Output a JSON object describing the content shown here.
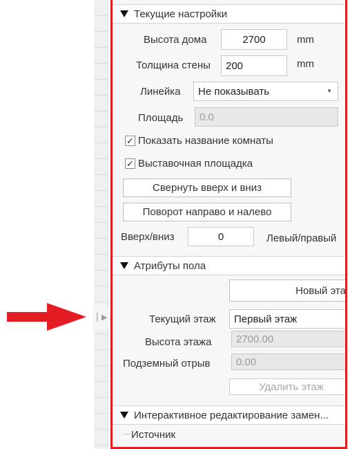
{
  "current_settings": {
    "header": "Текущие настройки",
    "house_height_label": "Высота дома",
    "house_height_value": "2700",
    "house_height_unit": "mm",
    "wall_thickness_label": "Толщина стены",
    "wall_thickness_value": "200",
    "wall_thickness_unit": "mm",
    "ruler_label": "Линейка",
    "ruler_value": "Не показывать",
    "area_label": "Площадь",
    "area_value": "0.0",
    "show_room_name_label": "Показать название комнаты",
    "show_room_name_checked": true,
    "exhibition_area_label": "Выставочная площадка",
    "exhibition_area_checked": true,
    "flip_button": "Свернуть вверх и вниз",
    "rotate_button": "Поворот направо и налево",
    "updown_label": "Вверх/вниз",
    "updown_value": "0",
    "leftright_label": "Левый/правый"
  },
  "floor_attributes": {
    "header": "Атрибуты пола",
    "new_floor_button": "Новый этаж",
    "current_floor_label": "Текущий этаж",
    "current_floor_value": "Первый этаж",
    "floor_height_label": "Высота этажа",
    "floor_height_value": "2700.00",
    "underground_label": "Подземный отрыв",
    "underground_value": "0.00",
    "delete_floor_button": "Удалить этаж"
  },
  "interactive_edit": {
    "header": "Интерактивное редактирование замен...",
    "source_label": "Источник"
  },
  "colors": {
    "highlight": "#e31b23",
    "arrow": "#e31b23"
  },
  "icons": {
    "collapse_handle": "collapse-panel-icon",
    "section_toggle": "triangle-down-icon",
    "checkbox": "checkmark-icon",
    "arrow": "red-arrow"
  }
}
